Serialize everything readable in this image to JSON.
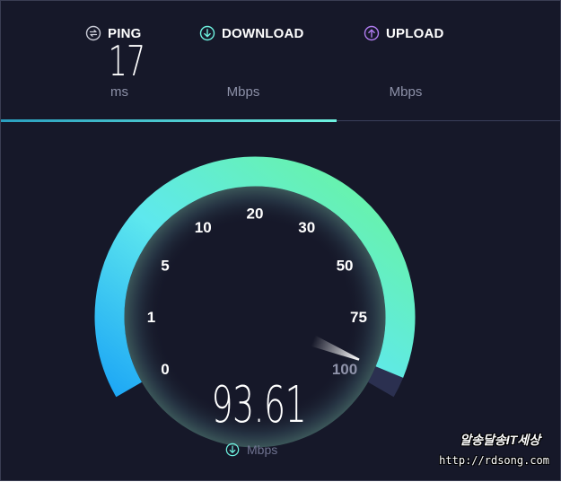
{
  "metrics": {
    "ping": {
      "label": "PING",
      "value": "17",
      "unit": "ms",
      "icon": "ping-arrows-icon"
    },
    "download": {
      "label": "DOWNLOAD",
      "value": "",
      "unit": "Mbps",
      "icon": "download-arrow-icon"
    },
    "upload": {
      "label": "UPLOAD",
      "value": "",
      "unit": "Mbps",
      "icon": "upload-arrow-icon"
    }
  },
  "progress": {
    "fraction": 0.6
  },
  "gauge": {
    "scale_labels": [
      "0",
      "1",
      "5",
      "10",
      "20",
      "30",
      "50",
      "75",
      "100"
    ],
    "current_speed": "93.61",
    "current_speed_number": 93.61,
    "unit": "Mbps",
    "unit_icon": "download-arrow-icon"
  },
  "watermark": {
    "title": "알송달송IT세상",
    "url": "http://rdsong.com"
  },
  "colors": {
    "background": "#161829",
    "ping_icon": "#c9cbd6",
    "download_accent": "#6ef2e0",
    "upload_accent": "#b07cf0",
    "gauge_start": "#22a6f0",
    "gauge_end": "#6af5a0"
  }
}
